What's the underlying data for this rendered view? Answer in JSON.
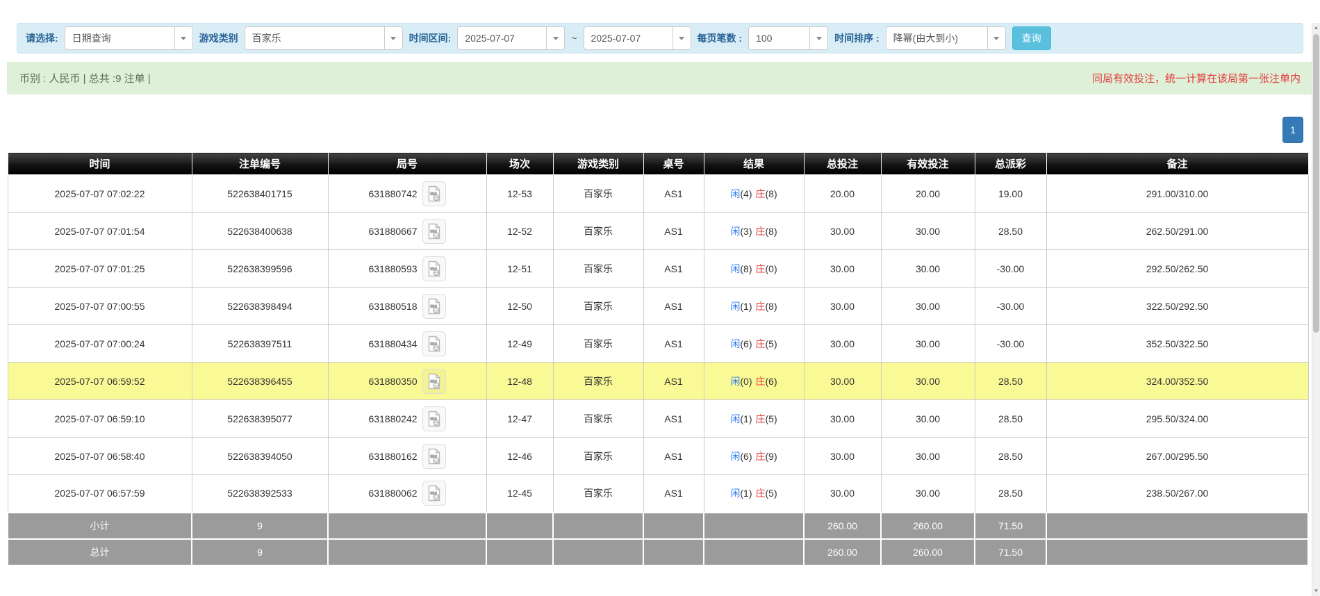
{
  "filter_bar": {
    "select_label": "请选择:",
    "query_type": "日期查询",
    "game_label": "游戏类别",
    "game_type": "百家乐",
    "time_range_label": "时间区间:",
    "date_from": "2025-07-07",
    "range_separator": "~",
    "date_to": "2025-07-07",
    "page_size_label": "每页笔数 :",
    "page_size": "100",
    "sort_label": "时间排序 :",
    "sort_order": "降幂(由大到小)",
    "search_button": "查询"
  },
  "info_bar": {
    "summary": "币别 : 人民币 | 总共 :9 注单 |",
    "notice": "同局有效投注，统一计算在该局第一张注单内"
  },
  "pagination": {
    "page": "1"
  },
  "table": {
    "headers": [
      "时间",
      "注单编号",
      "局号",
      "场次",
      "游戏类别",
      "桌号",
      "结果",
      "总投注",
      "有效投注",
      "总派彩",
      "备注"
    ],
    "result_labels": {
      "player": "闲",
      "banker": "庄"
    },
    "rows": [
      {
        "time": "2025-07-07 07:02:22",
        "bet_id": "522638401715",
        "round_id": "631880742",
        "session": "12-53",
        "game": "百家乐",
        "table_no": "AS1",
        "result": {
          "player": "4",
          "banker": "8"
        },
        "total_bet": "20.00",
        "valid_bet": "20.00",
        "payout": "19.00",
        "remark": "291.00/310.00",
        "highlight": false
      },
      {
        "time": "2025-07-07 07:01:54",
        "bet_id": "522638400638",
        "round_id": "631880667",
        "session": "12-52",
        "game": "百家乐",
        "table_no": "AS1",
        "result": {
          "player": "3",
          "banker": "8"
        },
        "total_bet": "30.00",
        "valid_bet": "30.00",
        "payout": "28.50",
        "remark": "262.50/291.00",
        "highlight": false
      },
      {
        "time": "2025-07-07 07:01:25",
        "bet_id": "522638399596",
        "round_id": "631880593",
        "session": "12-51",
        "game": "百家乐",
        "table_no": "AS1",
        "result": {
          "player": "8",
          "banker": "0"
        },
        "total_bet": "30.00",
        "valid_bet": "30.00",
        "payout": "-30.00",
        "remark": "292.50/262.50",
        "highlight": false
      },
      {
        "time": "2025-07-07 07:00:55",
        "bet_id": "522638398494",
        "round_id": "631880518",
        "session": "12-50",
        "game": "百家乐",
        "table_no": "AS1",
        "result": {
          "player": "1",
          "banker": "8"
        },
        "total_bet": "30.00",
        "valid_bet": "30.00",
        "payout": "-30.00",
        "remark": "322.50/292.50",
        "highlight": false
      },
      {
        "time": "2025-07-07 07:00:24",
        "bet_id": "522638397511",
        "round_id": "631880434",
        "session": "12-49",
        "game": "百家乐",
        "table_no": "AS1",
        "result": {
          "player": "6",
          "banker": "5"
        },
        "total_bet": "30.00",
        "valid_bet": "30.00",
        "payout": "-30.00",
        "remark": "352.50/322.50",
        "highlight": false
      },
      {
        "time": "2025-07-07 06:59:52",
        "bet_id": "522638396455",
        "round_id": "631880350",
        "session": "12-48",
        "game": "百家乐",
        "table_no": "AS1",
        "result": {
          "player": "0",
          "banker": "6"
        },
        "total_bet": "30.00",
        "valid_bet": "30.00",
        "payout": "28.50",
        "remark": "324.00/352.50",
        "highlight": true
      },
      {
        "time": "2025-07-07 06:59:10",
        "bet_id": "522638395077",
        "round_id": "631880242",
        "session": "12-47",
        "game": "百家乐",
        "table_no": "AS1",
        "result": {
          "player": "1",
          "banker": "5"
        },
        "total_bet": "30.00",
        "valid_bet": "30.00",
        "payout": "28.50",
        "remark": "295.50/324.00",
        "highlight": false
      },
      {
        "time": "2025-07-07 06:58:40",
        "bet_id": "522638394050",
        "round_id": "631880162",
        "session": "12-46",
        "game": "百家乐",
        "table_no": "AS1",
        "result": {
          "player": "6",
          "banker": "9"
        },
        "total_bet": "30.00",
        "valid_bet": "30.00",
        "payout": "28.50",
        "remark": "267.00/295.50",
        "highlight": false
      },
      {
        "time": "2025-07-07 06:57:59",
        "bet_id": "522638392533",
        "round_id": "631880062",
        "session": "12-45",
        "game": "百家乐",
        "table_no": "AS1",
        "result": {
          "player": "1",
          "banker": "5"
        },
        "total_bet": "30.00",
        "valid_bet": "30.00",
        "payout": "28.50",
        "remark": "238.50/267.00",
        "highlight": false
      }
    ],
    "footer": [
      {
        "label": "小计",
        "count": "9",
        "total_bet": "260.00",
        "valid_bet": "260.00",
        "payout": "71.50"
      },
      {
        "label": "总计",
        "count": "9",
        "total_bet": "260.00",
        "valid_bet": "260.00",
        "payout": "71.50"
      }
    ]
  },
  "colors": {
    "filter_bar_bg": "#d9edf7",
    "info_bar_bg": "#dff0d8",
    "notice_red": "#e23b3b",
    "search_button_bg": "#5bc0de",
    "pagination_bg": "#337ab7",
    "player_blue": "#2b7bf6",
    "banker_red": "#e23b3b",
    "highlight_yellow": "#f9f995",
    "header_black": "#000000",
    "footer_gray": "#9b9b9b"
  }
}
